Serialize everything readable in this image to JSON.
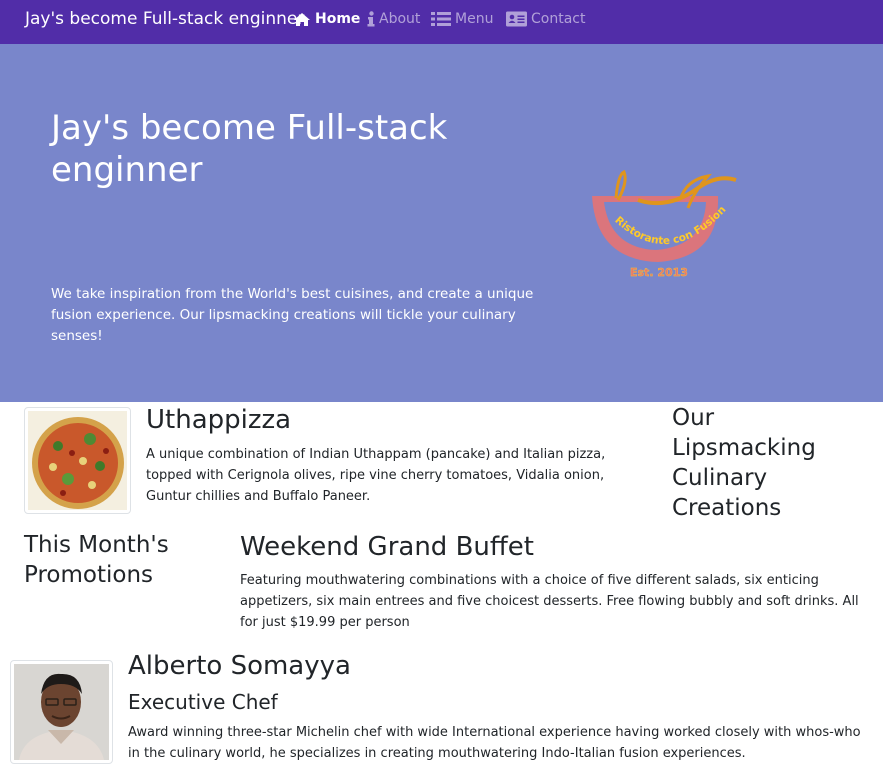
{
  "navbar": {
    "brand": "Jay's become Full-stack enginner",
    "items": [
      {
        "label": "Home",
        "icon": "home-icon",
        "active": true
      },
      {
        "label": "About",
        "icon": "info-icon",
        "active": false
      },
      {
        "label": "Menu",
        "icon": "list-icon",
        "active": false
      },
      {
        "label": "Contact",
        "icon": "address-card-icon",
        "active": false
      }
    ]
  },
  "colors": {
    "navbar": "#512DA8",
    "jumbotron": "#7986CB",
    "logo_accent": "#E57373"
  },
  "jumbotron": {
    "title": "Jay's become Full-stack enginner",
    "text": "We take inspiration from the World's best cuisines, and create a unique fusion experience. Our lipsmacking creations will tickle your culinary senses!",
    "logo": {
      "text": "Ristorante con Fusion",
      "est": "Est. 2013"
    }
  },
  "dish": {
    "heading": "Our Lipsmacking Culinary Creations",
    "name": "Uthappizza",
    "description": "A unique combination of Indian Uthappam (pancake) and Italian pizza, topped with Cerignola olives, ripe vine cherry tomatoes, Vidalia onion, Guntur chillies and Buffalo Paneer."
  },
  "promotion": {
    "heading": "This Month's Promotions",
    "name": "Weekend Grand Buffet",
    "description": "Featuring mouthwatering combinations with a choice of five different salads, six enticing appetizers, six main entrees and five choicest desserts. Free flowing bubbly and soft drinks. All for just $19.99 per person"
  },
  "leader": {
    "name": "Alberto Somayya",
    "designation": "Executive Chef",
    "description": "Award winning three-star Michelin chef with wide International experience having worked closely with whos-who in the culinary world, he specializes in creating mouthwatering Indo-Italian fusion experiences."
  }
}
